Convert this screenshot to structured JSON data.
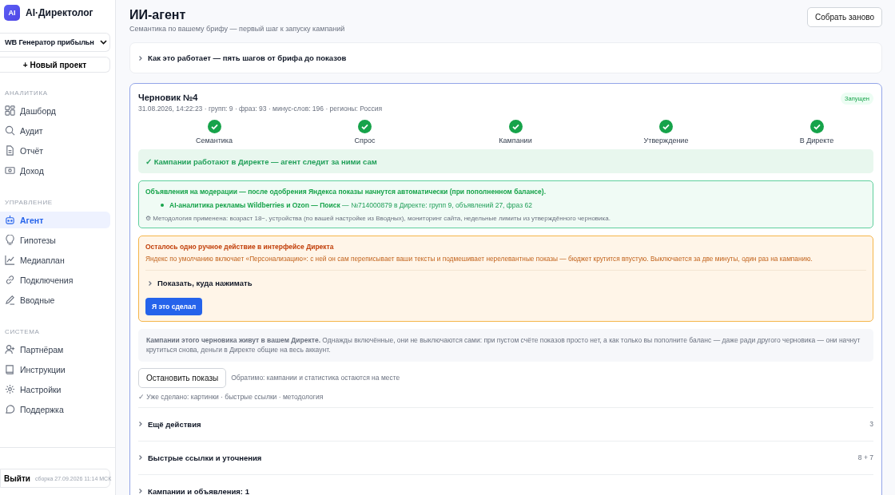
{
  "brand": {
    "logo": "AI",
    "name": "AI·Директолог"
  },
  "project_select": {
    "value": "WB Генератор прибыльн"
  },
  "new_project_button": "+ Новый проект",
  "sidebar": [
    {
      "heading": "АНАЛИТИКА",
      "items": [
        {
          "label": "Дашборд",
          "selected": false
        },
        {
          "label": "Аудит",
          "selected": false
        },
        {
          "label": "Отчёт",
          "selected": false
        },
        {
          "label": "Доход",
          "selected": false
        }
      ]
    },
    {
      "heading": "УПРАВЛЕНИЕ",
      "items": [
        {
          "label": "Агент",
          "selected": true
        },
        {
          "label": "Гипотезы",
          "selected": false
        },
        {
          "label": "Медиаплан",
          "selected": false
        },
        {
          "label": "Подключения",
          "selected": false
        },
        {
          "label": "Вводные",
          "selected": false
        }
      ]
    },
    {
      "heading": "СИСТЕМА",
      "items": [
        {
          "label": "Партнёрам",
          "selected": false
        },
        {
          "label": "Инструкции",
          "selected": false
        },
        {
          "label": "Настройки",
          "selected": false
        },
        {
          "label": "Поддержка",
          "selected": false
        }
      ]
    }
  ],
  "footer": {
    "logout": "Выйти",
    "build": "сборка 27.09.2026 11:14 МСК"
  },
  "page": {
    "title": "ИИ-агент",
    "subtitle": "Семантика по вашему брифу — первый шаг к запуску кампаний",
    "rebuild_button": "Собрать заново"
  },
  "how_it_works": {
    "label": "Как это работает — пять шагов от брифа до показов",
    "expanded": false
  },
  "draft": {
    "title": "Черновик №4",
    "meta": "31.08.2026, 14:22:23 · групп: 9 · фраз: 93 · минус-слов: 196 · регионы: Россия",
    "status": "Запущен",
    "steps": [
      {
        "label": "Семантика",
        "done": true
      },
      {
        "label": "Спрос",
        "done": true
      },
      {
        "label": "Кампании",
        "done": true
      },
      {
        "label": "Утверждение",
        "done": true
      },
      {
        "label": "В Директе",
        "done": true
      }
    ],
    "running_banner": "✓ Кампании работают в Директе — агент следит за ними сам",
    "moderation": {
      "title": "Объявления на модерации — после одобрения Яндекса показы начнутся автоматически (при пополненном балансе).",
      "campaigns": [
        {
          "name": "AI-аналитика рекламы Wildberries и Ozon — Поиск",
          "details": " — №714000879 в Директе: групп 9, объявлений 27, фраз 62"
        }
      ],
      "methodology": "⚙ Методология применена: возраст 18−, устройства (по вашей настройке из Вводных), мониторинг сайта, недельные лимиты из утверждённого черновика."
    },
    "manual_action": {
      "title": "Осталось одно ручное действие в интерфейсе Директа",
      "text": "Яндекс по умолчанию включает «Персонализацию»: с ней он сам переписывает ваши тексты и подмешивает нерелевантные показы — бюджет крутится впустую. Выключается за две минуты, один раз на кампанию.",
      "toggle": "Показать, куда нажимать",
      "expanded": false,
      "done_button": "Я это сделал"
    },
    "info": "**Кампании этого черновика живут в вашем Директе.** Однажды включённые, они не выключаются сами: при пустом счёте показов просто нет, а как только вы пополните баланс — даже ради другого черновика — они начнут крутиться снова, деньги в Директе общие на весь аккаунт.",
    "stop_button": "Остановить показы",
    "stop_hint": "Обратимо: кампании и статистика остаются на месте",
    "already_done": "✓ Уже сделано: картинки · быстрые ссылки · методология",
    "sections": [
      {
        "label": "Ещё действия",
        "count": "3",
        "expanded": false
      },
      {
        "label": "Быстрые ссылки и уточнения",
        "count": "8 + 7",
        "expanded": false
      },
      {
        "label": "Кампании и объявления: 1",
        "expanded": false
      }
    ]
  }
}
